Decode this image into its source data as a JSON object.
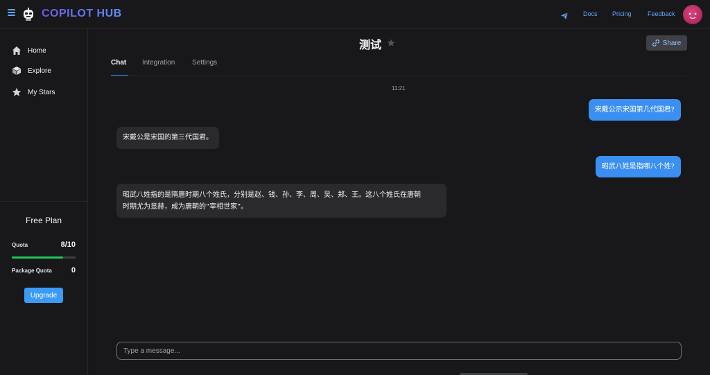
{
  "header": {
    "brand": "COPILOT HUB",
    "nav": [
      {
        "label": "Docs"
      },
      {
        "label": "Pricing"
      },
      {
        "label": "Feedback"
      }
    ],
    "colors": {
      "accent": "#60a5fa",
      "brand_start": "#6d5de8",
      "brand_end": "#5b8ef5",
      "avatar": "#c2306d"
    }
  },
  "sidebar": {
    "items": [
      {
        "label": "Home",
        "icon": "home-icon"
      },
      {
        "label": "Explore",
        "icon": "cube-icon"
      },
      {
        "label": "My Stars",
        "icon": "star-icon"
      }
    ],
    "plan": {
      "title": "Free Plan",
      "quota_label": "Quota",
      "quota_value": "8/10",
      "quota_fraction": 0.8,
      "package_label": "Package Quota",
      "package_value": "0",
      "upgrade_label": "Upgrade"
    }
  },
  "main": {
    "title": "测试",
    "share_label": "Share",
    "tabs": [
      {
        "label": "Chat",
        "active": true
      },
      {
        "label": "Integration",
        "active": false
      },
      {
        "label": "Settings",
        "active": false
      }
    ],
    "timestamp": "11:21",
    "messages": [
      {
        "role": "user",
        "lines": [
          "宋戴公示宋国第几代国君?"
        ]
      },
      {
        "role": "bot",
        "lines": [
          "宋戴公是宋国的第三代国君。"
        ]
      },
      {
        "role": "user",
        "lines": [
          "昭武八姓是指哪八个姓?"
        ]
      },
      {
        "role": "bot",
        "lines": [
          "昭武八姓指的是隋唐时期八个姓氏，分别是赵、钱、孙、李、周、吴、郑、王。这八个姓氏在唐朝",
          "时期尤为显赫，成为唐朝的“宰相世家”。"
        ]
      }
    ],
    "input_placeholder": "Type a message..."
  }
}
